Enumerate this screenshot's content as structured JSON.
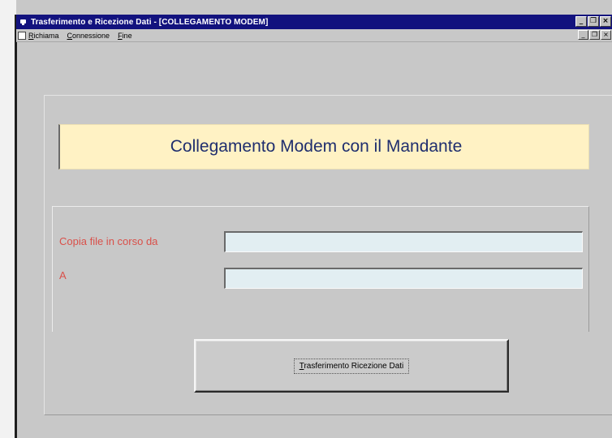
{
  "window": {
    "title": "Trasferimento e Ricezione Dati - [COLLEGAMENTO MODEM]",
    "minimize_glyph": "_",
    "restore_glyph": "❐",
    "close_glyph": "×"
  },
  "menu": {
    "items": [
      {
        "accel": "R",
        "rest": "ichiama"
      },
      {
        "accel": "C",
        "rest": "onnessione"
      },
      {
        "accel": "F",
        "rest": "ine"
      }
    ]
  },
  "banner": {
    "text": "Collegamento Modem con il Mandante"
  },
  "form": {
    "from_label": "Copia file in corso da",
    "from_value": "",
    "to_label": "A",
    "to_value": ""
  },
  "action": {
    "accel": "T",
    "rest": "rasferimento Ricezione Dati"
  },
  "colors": {
    "title_bar": "#12127e",
    "banner_bg": "#fff2c4",
    "banner_text": "#1f2e6e",
    "label_text": "#d9504a",
    "input_bg": "#e2eef2",
    "window_bg": "#c8c8c8"
  },
  "icons": {
    "app": "app-icon",
    "document": "document-icon"
  }
}
